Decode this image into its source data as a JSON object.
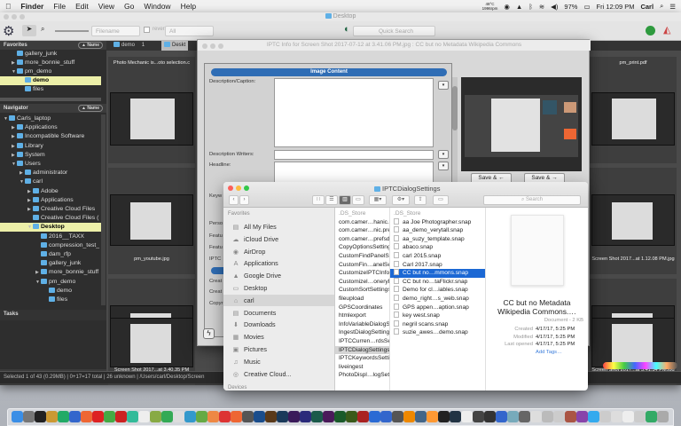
{
  "menubar": {
    "app": "Finder",
    "items": [
      "File",
      "Edit",
      "View",
      "Go",
      "Window",
      "Help"
    ],
    "temp": "48°C",
    "rpm": "1996rpm",
    "battery": "97%",
    "clock": "Fri 12:09 PM",
    "user": "Carl"
  },
  "pm": {
    "title": "Desktop",
    "sort_field": "Filename",
    "reverse_label": "reverse",
    "filter": "All",
    "quick_search_placeholder": "Quick Search",
    "favorites": {
      "header": "Favorites",
      "sort": "▲ Name",
      "items": [
        {
          "label": "gallery_junk",
          "indent": 1,
          "arrow": ""
        },
        {
          "label": "more_bonnie_stuff",
          "indent": 1,
          "arrow": "▶"
        },
        {
          "label": "pm_demo",
          "indent": 1,
          "arrow": "▼"
        },
        {
          "label": "demo",
          "indent": 2,
          "arrow": "",
          "selected": true
        },
        {
          "label": "files",
          "indent": 2,
          "arrow": ""
        }
      ]
    },
    "navigator": {
      "header": "Navigator",
      "sort": "▲ Name",
      "items": [
        {
          "label": "Carls_laptop",
          "indent": 0,
          "arrow": "▼"
        },
        {
          "label": "Applications",
          "indent": 1,
          "arrow": "▶"
        },
        {
          "label": "Incompatible Software",
          "indent": 1,
          "arrow": "▶"
        },
        {
          "label": "Library",
          "indent": 1,
          "arrow": "▶"
        },
        {
          "label": "System",
          "indent": 1,
          "arrow": "▶"
        },
        {
          "label": "Users",
          "indent": 1,
          "arrow": "▼"
        },
        {
          "label": "administrator",
          "indent": 2,
          "arrow": "▶"
        },
        {
          "label": "carl",
          "indent": 2,
          "arrow": "▼"
        },
        {
          "label": "Adobe",
          "indent": 3,
          "arrow": "▶"
        },
        {
          "label": "Applications",
          "indent": 3,
          "arrow": "▶"
        },
        {
          "label": "Creative Cloud Files",
          "indent": 3,
          "arrow": "▶"
        },
        {
          "label": "Creative Cloud Files (",
          "indent": 3,
          "arrow": ""
        },
        {
          "label": "Desktop",
          "indent": 3,
          "arrow": "▼",
          "selected": true
        },
        {
          "label": "2016__TAXX",
          "indent": 4,
          "arrow": ""
        },
        {
          "label": "compression_test_",
          "indent": 4,
          "arrow": ""
        },
        {
          "label": "dam_rfp",
          "indent": 4,
          "arrow": ""
        },
        {
          "label": "gallery_junk",
          "indent": 4,
          "arrow": ""
        },
        {
          "label": "more_bonnie_stuff",
          "indent": 4,
          "arrow": "▶"
        },
        {
          "label": "pm_demo",
          "indent": 4,
          "arrow": "▼"
        },
        {
          "label": "demo",
          "indent": 5,
          "arrow": ""
        },
        {
          "label": "files",
          "indent": 5,
          "arrow": ""
        }
      ]
    },
    "tasks_header": "Tasks",
    "tabs": [
      {
        "label": "demo",
        "count": "1"
      },
      {
        "label": "Deskt"
      }
    ],
    "thumbs": [
      "Photo Mechanic is...oto selection.c",
      "pm_youtube.jpg",
      "Screen Shot 2017...at 3.40.35 PM",
      "pm_print.pdf",
      "Screen Shot 2017...at 1.12.08 PM.jpg",
      "Screen Shot 2017...at 3.41.34 PM.jpg"
    ],
    "status": "Selected 1 of 43 (0.29MB) | 0+17=17 total | 26 unknown | /Users/carl/Desktop/Screen"
  },
  "iptc": {
    "title": "IPTC Info for Screen Shot 2017-07-12 at 3.41.06 PM.jpg : CC but no Metadata Wikipedia Commons",
    "section": "Image Content",
    "labels": [
      "Description/Caption:",
      "Description Writers:",
      "Headline:",
      "Keyw",
      "Perso",
      "Featu",
      "Featu",
      "IPTC",
      "Creat",
      "Creat",
      "Copyr"
    ],
    "save_prev": "Save & ←",
    "save_next": "Save & →"
  },
  "finder": {
    "title": "IPTCDialogSettings",
    "search_placeholder": "Search",
    "favorites_label": "Favorites",
    "devices_label": "Devices",
    "sidebar": [
      {
        "label": "All My Files",
        "icon": "▤"
      },
      {
        "label": "iCloud Drive",
        "icon": "☁"
      },
      {
        "label": "AirDrop",
        "icon": "◉"
      },
      {
        "label": "Applications",
        "icon": "A"
      },
      {
        "label": "Google Drive",
        "icon": "▲"
      },
      {
        "label": "Desktop",
        "icon": "▭"
      },
      {
        "label": "carl",
        "icon": "⌂",
        "selected": true
      },
      {
        "label": "Documents",
        "icon": "▤"
      },
      {
        "label": "Downloads",
        "icon": "⬇"
      },
      {
        "label": "Movies",
        "icon": "▦"
      },
      {
        "label": "Pictures",
        "icon": "▣"
      },
      {
        "label": "Music",
        "icon": "♫"
      },
      {
        "label": "Creative Cloud...",
        "icon": "◎"
      }
    ],
    "column1": [
      ".DS_Store",
      "com.camer…hanic.prefs",
      "com.camer…nic.prefsdb",
      "com.camer…prefsdb.bak",
      "CopyOptionsSettings",
      "CustomFindPanelSettings",
      "CustomFin…anelSettings",
      "CustomizeIPTCInfoDialog",
      "Customizel…oneryDialog",
      "CustomSortSettings",
      "fileupload",
      "GPSCoordinates",
      "htmlexport",
      "InfoVariableDialogSettings",
      "IngestDialogSettings",
      "IPTCCurren…rdsSettings",
      "IPTCDialogSettings",
      "IPTCKeywordsSettings",
      "liveingest",
      "PhotoDispl…logSettings"
    ],
    "column2": [
      ".DS_Store",
      "aa Joe Photographer.snap",
      "aa_demo_verytall.snap",
      "aa_suzy_template.snap",
      "abaco.snap",
      "carl 2015.snap",
      "Carl 2017.snap",
      "CC but no…mmons.snap",
      "CC but no…taFlickr.snap",
      "Demo for cl…iables.snap",
      "demo_right…s_web.snap",
      "GPS appen…aption.snap",
      "key west.snap",
      "negril scans.snap",
      "suzie_awes…demo.snap"
    ],
    "preview": {
      "name": "CC but no Metadata Wikipedia Commons.…",
      "kind": "Document - 2 KB",
      "created_label": "Created",
      "created": "4/17/17, 5:25 PM",
      "modified_label": "Modified",
      "modified": "4/17/17, 5:25 PM",
      "opened_label": "Last opened",
      "opened": "4/17/17, 5:25 PM",
      "tags": "Add Tags…"
    }
  },
  "colors": {
    "selection": "#1c68d4",
    "tree_highlight": "#ecefa8",
    "folder": "#5fb0e6",
    "iptc_header": "#2f6db5"
  }
}
